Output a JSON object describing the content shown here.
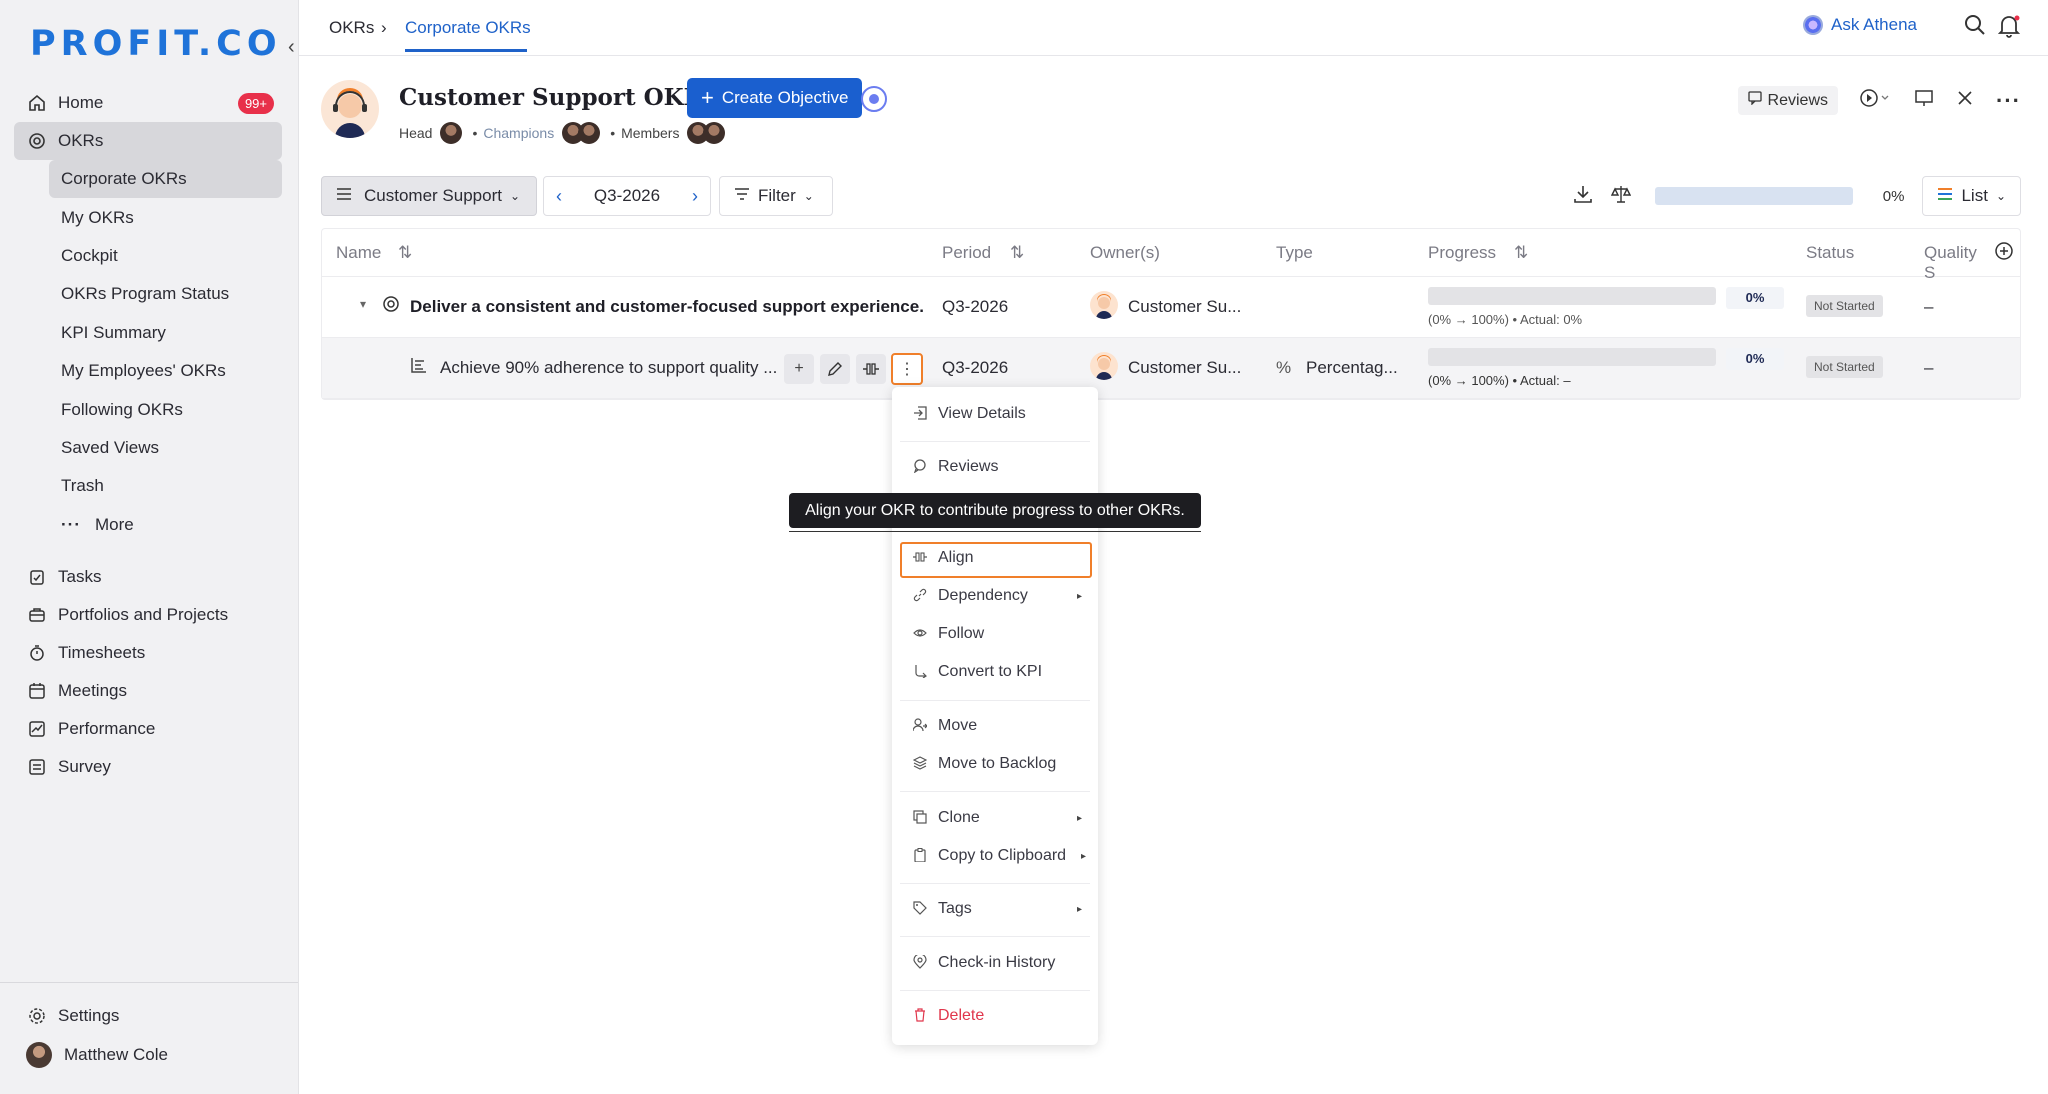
{
  "brand": {
    "logo_text": "PROFIT.CO",
    "accent": "#1f73d9"
  },
  "sidebar": {
    "collapse_glyph": "‹",
    "home": {
      "label": "Home",
      "badge": "99+"
    },
    "okrs": {
      "label": "OKRs"
    },
    "okr_items": [
      {
        "label": "Corporate OKRs"
      },
      {
        "label": "My OKRs"
      },
      {
        "label": "Cockpit"
      },
      {
        "label": "OKRs Program Status"
      },
      {
        "label": "KPI Summary"
      },
      {
        "label": "My Employees' OKRs"
      },
      {
        "label": "Following OKRs"
      },
      {
        "label": "Saved Views"
      },
      {
        "label": "Trash"
      }
    ],
    "more": {
      "dots": "···",
      "label": "More"
    },
    "sections": [
      {
        "label": "Tasks",
        "icon": "clipboard-check-icon"
      },
      {
        "label": "Portfolios and Projects",
        "icon": "briefcase-icon"
      },
      {
        "label": "Timesheets",
        "icon": "stopwatch-icon"
      },
      {
        "label": "Meetings",
        "icon": "calendar-icon"
      },
      {
        "label": "Performance",
        "icon": "trend-chart-icon"
      },
      {
        "label": "Survey",
        "icon": "survey-list-icon"
      }
    ],
    "settings": {
      "label": "Settings"
    },
    "user": {
      "name": "Matthew Cole"
    }
  },
  "topbar": {
    "breadcrumb_root": "OKRs",
    "breadcrumb_sep": "›",
    "breadcrumb_active": "Corporate OKRs",
    "ask_label": "Ask Athena"
  },
  "header": {
    "title": "Customer Support OKRs",
    "create_label": "Create Objective",
    "create_plus": "+",
    "head_label": "Head",
    "bullet": "•",
    "champions_label": "Champions",
    "members_label": "Members",
    "reviews_label": "Reviews"
  },
  "toolbar": {
    "department": "Customer Support",
    "prev": "‹",
    "next": "›",
    "period": "Q3-2026",
    "filter_label": "Filter",
    "overall_progress": "0%",
    "overall_progress_value": 0,
    "view_label": "List"
  },
  "table": {
    "columns": [
      "Name",
      "Period",
      "Owner(s)",
      "Type",
      "Progress",
      "Status",
      "Quality S"
    ],
    "rows": [
      {
        "name": "Deliver a consistent and customer-focused support experience.",
        "period": "Q3-2026",
        "owner": "Customer Su...",
        "type": "",
        "progress": "0%",
        "progress_value": 0,
        "progress_detail": "(0% → 100%) • Actual: 0%",
        "status": "Not Started",
        "quality": "–"
      },
      {
        "name": "Achieve 90% adherence to support quality ...",
        "period": "Q3-2026",
        "owner": "Customer Su...",
        "type": "Percentag...",
        "type_icon": "%",
        "progress": "0%",
        "progress_value": 0,
        "progress_detail": "(0% → 100%) • Actual: –",
        "status": "Not Started",
        "quality": "–"
      }
    ],
    "row_actions": {
      "add": "+",
      "kebab": "⋮"
    }
  },
  "context_menu": {
    "items": {
      "view_details": "View Details",
      "reviews": "Reviews",
      "align": "Align",
      "dependency": "Dependency",
      "follow": "Follow",
      "convert_kpi": "Convert to KPI",
      "move": "Move",
      "move_backlog": "Move to Backlog",
      "clone": "Clone",
      "copy_clipboard": "Copy to Clipboard",
      "tags": "Tags",
      "checkin_history": "Check-in History",
      "delete": "Delete"
    },
    "submenu_arrow": "▸"
  },
  "tooltip": {
    "text": "Align your OKR to contribute progress to other OKRs."
  },
  "colors": {
    "primary": "#1a5fcf",
    "highlight": "#f07f2a",
    "danger": "#e0364c",
    "badge": "#e8304a"
  }
}
